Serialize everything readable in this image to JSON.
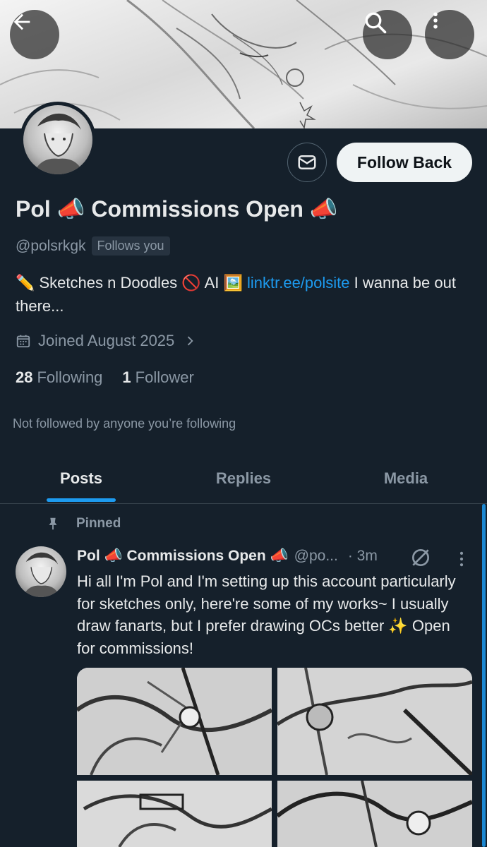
{
  "header": {
    "back_icon": "arrow-left-icon",
    "search_icon": "search-icon",
    "more_icon": "more-vertical-icon"
  },
  "profile": {
    "display_name": "Pol 📣 Commissions Open 📣",
    "handle": "@polsrkgk",
    "follows_you": "Follows you",
    "follow_button": "Follow Back",
    "bio_prefix": "✏️ Sketches n Doodles 🚫 AI  🖼️ ",
    "bio_link": "linktr.ee/polsite",
    "bio_suffix": " I wanna be out there...",
    "joined": "Joined August 2025",
    "following_count": "28",
    "following_label": "Following",
    "followers_count": "1",
    "followers_label": "Follower",
    "not_followed": "Not followed by anyone you’re following"
  },
  "tabs": [
    {
      "label": "Posts"
    },
    {
      "label": "Replies"
    },
    {
      "label": "Media"
    }
  ],
  "post": {
    "pinned_label": "Pinned",
    "name": "Pol 📣 Commissions Open 📣",
    "handle": "@po...",
    "time": "· 3m",
    "text": "Hi all I'm Pol and I'm setting up this account particularly for sketches only, here're some of my works~ I usually draw fanarts, but I prefer drawing OCs better ✨ Open for commissions!"
  },
  "colors": {
    "background": "#15202b",
    "accent": "#1d9bf0",
    "muted": "#8b98a5"
  }
}
